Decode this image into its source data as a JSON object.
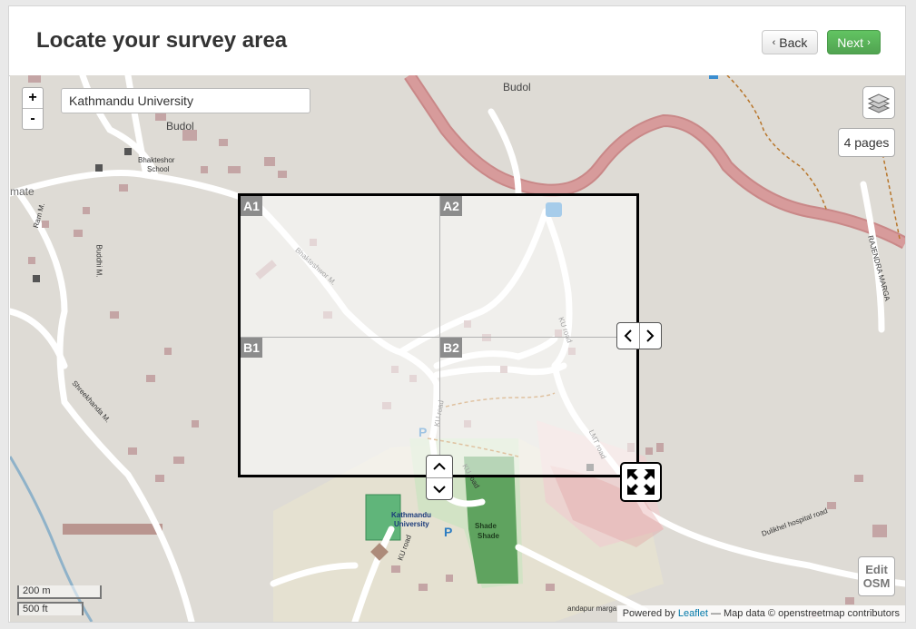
{
  "header": {
    "title": "Locate your survey area",
    "back_label": "Back",
    "next_label": "Next"
  },
  "map": {
    "search_value": "Kathmandu University",
    "zoom_in": "+",
    "zoom_out": "-",
    "pages_label": "4 pages",
    "grid_cells": [
      "A1",
      "A2",
      "B1",
      "B2"
    ],
    "edit_osm": [
      "Edit",
      "OSM"
    ],
    "scale_metric": "200 m",
    "scale_imperial": "500 ft",
    "attribution": {
      "prefix": "Powered by",
      "leaflet": "Leaflet",
      "rest": "— Map data © openstreetmap contributors"
    },
    "labels": {
      "budol": "Budol",
      "budol2": "Budol",
      "bhakteshor_school": "Bhakteshor",
      "school": "School",
      "mate": "mate",
      "ram_m": "Ram M.",
      "buddhi_m": "Buddhi M.",
      "shreekhanda": "Shreekhanda M.",
      "bhakteshwor": "Bhakteshwor M.",
      "ku_road1": "KU road",
      "ku_road2": "KU road",
      "ku_road3": "KU road",
      "ku_road4": "KU road",
      "lmt_road": "LMT road",
      "rajendra": "RAJENDRA MARGA",
      "dulikhel": "Dulikhel hospital road",
      "kathmandu_univ": "Kathmandu",
      "university": "University",
      "shade1": "Shade",
      "shade2": "Shade",
      "sandapur": "andapur marga"
    },
    "colors": {
      "accent_next": "#5bb75b",
      "main_road": "#d38a8a",
      "map_bg": "#dedbd5"
    }
  }
}
